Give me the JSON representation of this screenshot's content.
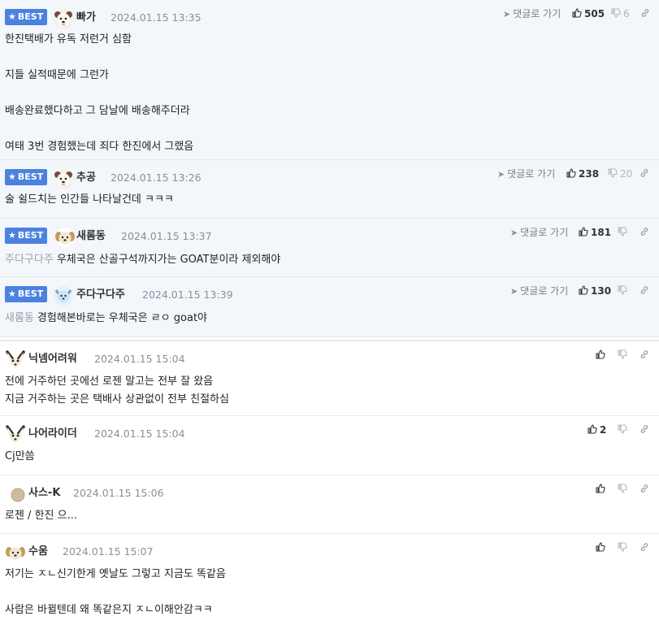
{
  "ui": {
    "best_label": "BEST",
    "reply_label": "댓글로 가기"
  },
  "comments": [
    {
      "best": true,
      "avatar": "white-dog",
      "nickname": "빠가",
      "date": "2024.01.15 13:35",
      "likes": "505",
      "dislikes": "6",
      "mention": "",
      "lines": [
        "한진택배가 유독 저런거 심함",
        "",
        "지들 실적때문에 그런가",
        "",
        "배송완료했다하고 그 담날에 배송해주더라",
        "",
        "여태 3번 경험했는데 죄다 한진에서 그랬음"
      ]
    },
    {
      "best": true,
      "avatar": "white-dog",
      "nickname": "추공",
      "date": "2024.01.15 13:26",
      "likes": "238",
      "dislikes": "20",
      "mention": "",
      "lines": [
        "술 쉴드치는 인간들 나타날건데 ㅋㅋㅋ"
      ]
    },
    {
      "best": true,
      "avatar": "puppy",
      "nickname": "새롬동",
      "date": "2024.01.15 13:37",
      "likes": "181",
      "dislikes": "",
      "mention": "주다구다주",
      "lines": [
        "우체국은 산골구석까지가는 GOAT분이라 제외해야"
      ]
    },
    {
      "best": true,
      "avatar": "blue-pet",
      "nickname": "주다구다주",
      "date": "2024.01.15 13:39",
      "likes": "130",
      "dislikes": "",
      "mention": "새롬동",
      "lines": [
        "경험해본바로는 우체국은 ㄹㅇ goat야"
      ]
    },
    {
      "best": false,
      "avatar": "fox",
      "nickname": "닉넴어려워",
      "date": "2024.01.15 15:04",
      "likes": "",
      "dislikes": "",
      "mention": "",
      "lines": [
        "전에 거주하던 곳에선 로젠 말고는 전부 잘 왔음",
        "지금 거주하는 곳은 택배사 상관없이 전부 친절하심"
      ]
    },
    {
      "best": false,
      "avatar": "fox",
      "nickname": "나어라이더",
      "date": "2024.01.15 15:04",
      "likes": "2",
      "dislikes": "",
      "mention": "",
      "lines": [
        "Cj만씀"
      ]
    },
    {
      "best": false,
      "avatar": "grey-dot",
      "nickname": "사스-K",
      "date": "2024.01.15 15:06",
      "likes": "",
      "dislikes": "",
      "mention": "",
      "lines": [
        "로젠 / 한진 으..."
      ]
    },
    {
      "best": false,
      "avatar": "puppy",
      "nickname": "수움",
      "date": "2024.01.15 15:07",
      "likes": "",
      "dislikes": "",
      "mention": "",
      "lines": [
        "저기는 ㅈㄴ신기한게 옛날도 그렇고 지금도 똑같음",
        "",
        "사람은 바뀔텐데 왜 똑같은지 ㅈㄴ이해안감ㅋㅋ"
      ]
    }
  ]
}
